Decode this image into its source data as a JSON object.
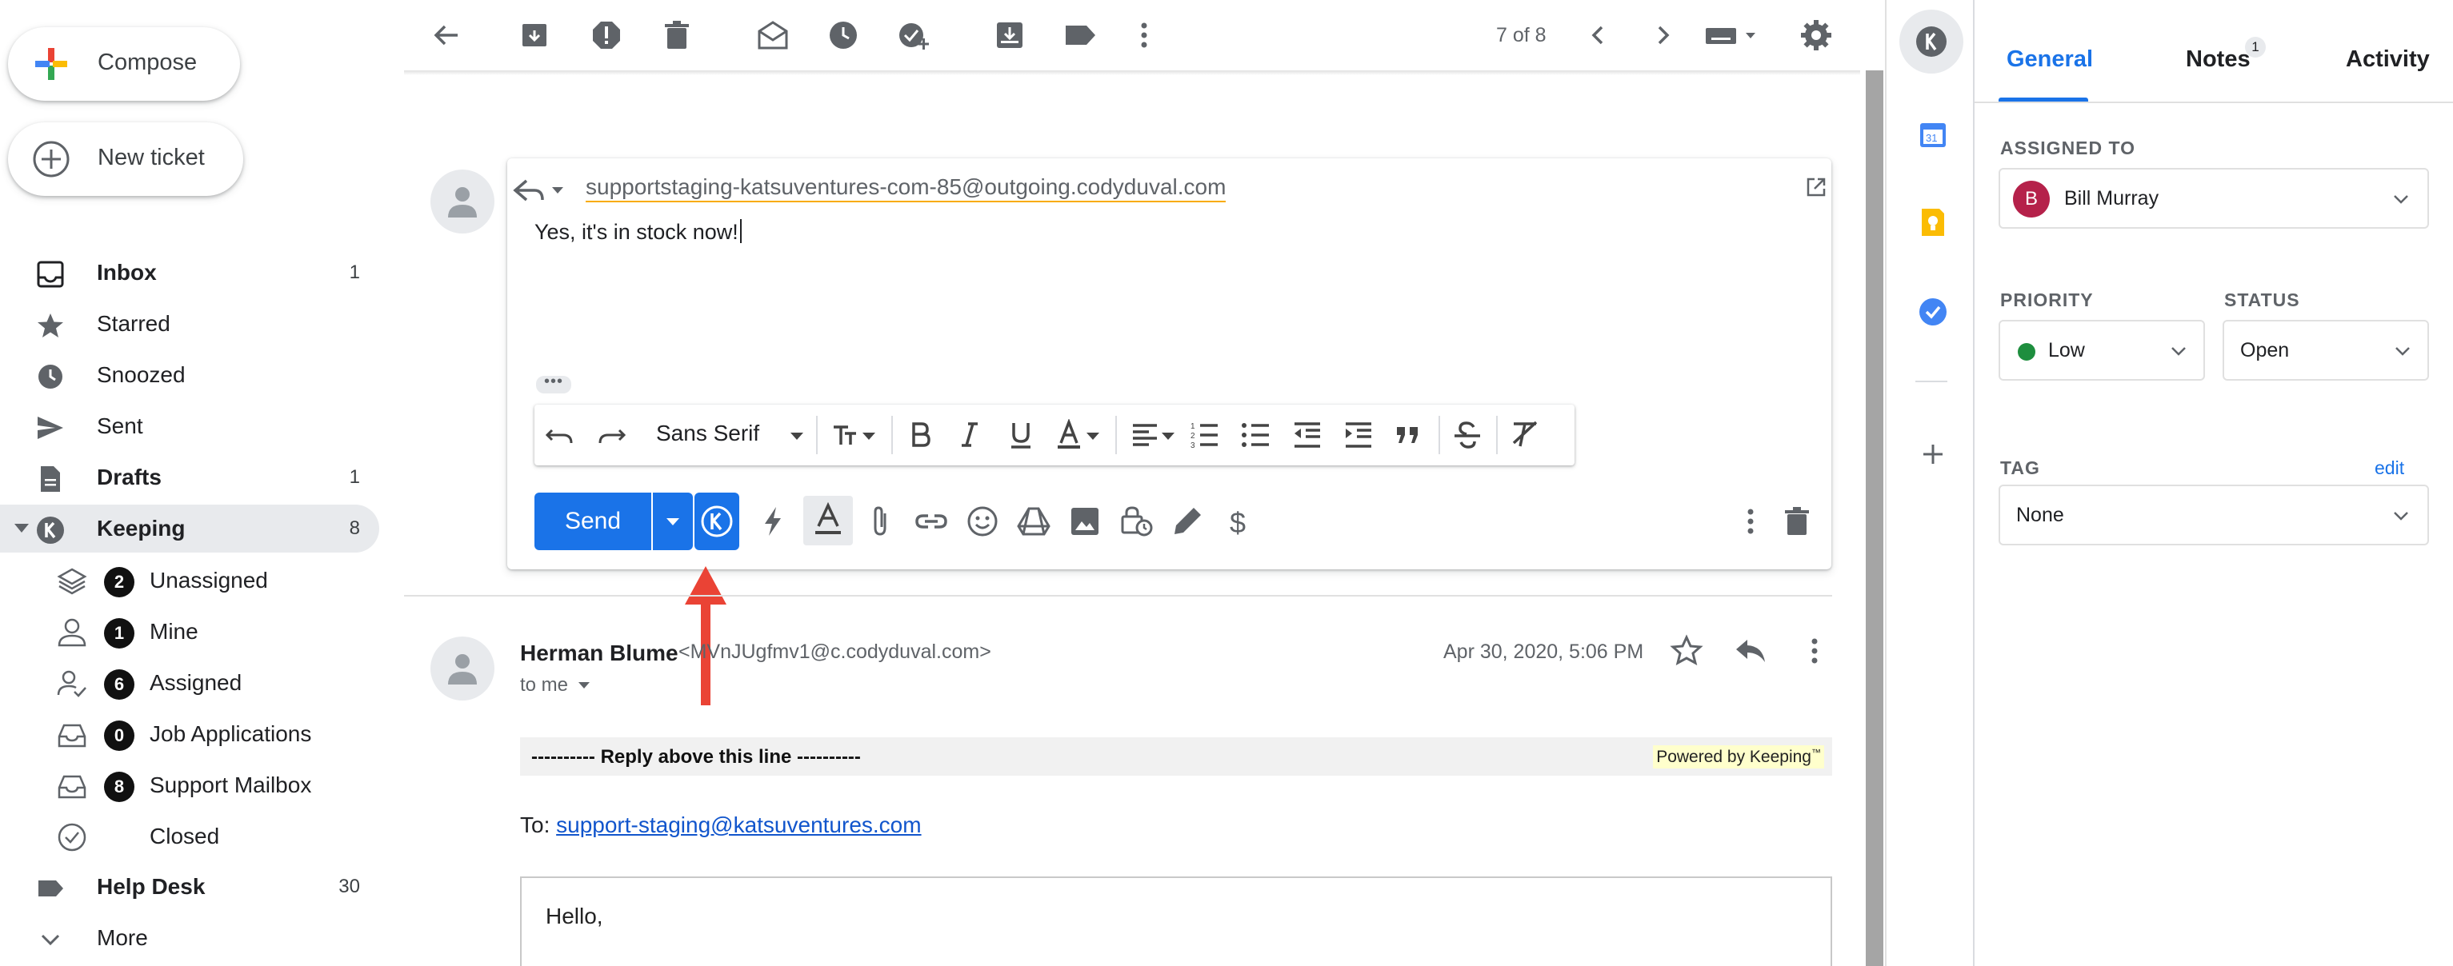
{
  "sidebar": {
    "compose_label": "Compose",
    "new_ticket_label": "New ticket",
    "items": [
      {
        "label": "Inbox",
        "count": "1"
      },
      {
        "label": "Starred",
        "count": ""
      },
      {
        "label": "Snoozed",
        "count": ""
      },
      {
        "label": "Sent",
        "count": ""
      },
      {
        "label": "Drafts",
        "count": "1"
      },
      {
        "label": "Keeping",
        "count": "8"
      }
    ],
    "keeping_sub": [
      {
        "badge": "2",
        "label": "Unassigned"
      },
      {
        "badge": "1",
        "label": "Mine"
      },
      {
        "badge": "6",
        "label": "Assigned"
      },
      {
        "badge": "0",
        "label": "Job Applications"
      },
      {
        "badge": "8",
        "label": "Support Mailbox"
      },
      {
        "badge": "",
        "label": "Closed"
      }
    ],
    "help_desk": {
      "label": "Help Desk",
      "count": "30"
    },
    "more_label": "More"
  },
  "toolbar": {
    "page_counter": "7 of 8"
  },
  "reply": {
    "to_address": "supportstaging-katsuventures-com-85@outgoing.codyduval.com",
    "body": "Yes, it's in stock now!",
    "font_name": "Sans Serif",
    "send_label": "Send"
  },
  "message": {
    "sender_name": "Herman Blume",
    "sender_email": "<MVnJUgfmv1@c.codyduval.com>",
    "to_me": "to me",
    "date": "Apr 30, 2020, 5:06 PM",
    "reply_line": "---------- Reply above this line ----------",
    "powered_by": "Powered by Keeping",
    "powered_mark": "™",
    "to_prefix": "To: ",
    "to_link": "support-staging@katsuventures.com",
    "greeting": "Hello,"
  },
  "panel": {
    "tabs": [
      {
        "label": "General",
        "active": true
      },
      {
        "label": "Notes",
        "badge": "1"
      },
      {
        "label": "Activity"
      }
    ],
    "assigned_to_label": "ASSIGNED TO",
    "assignee_initial": "B",
    "assignee_name": "Bill Murray",
    "priority_label": "PRIORITY",
    "priority_value": "Low",
    "status_label": "STATUS",
    "status_value": "Open",
    "tag_label": "TAG",
    "tag_edit": "edit",
    "tag_value": "None"
  },
  "colors": {
    "accent": "#1a73e8",
    "priority_low": "#1e8e3e",
    "assignee_avatar": "#b5214a",
    "annotation_arrow": "#ea4335"
  }
}
